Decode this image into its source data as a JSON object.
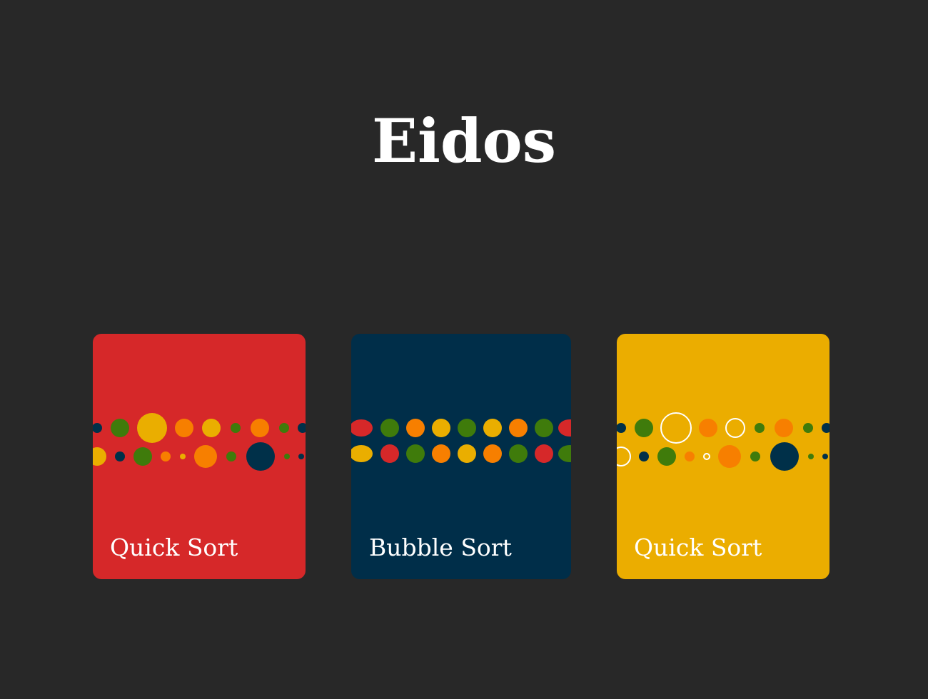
{
  "app": {
    "title": "Eidos"
  },
  "cards": [
    {
      "label": "Quick Sort",
      "background": "#d62829",
      "row1": [
        {
          "color": "#003049",
          "size": "sm"
        },
        {
          "color": "#3f7b0b",
          "size": "md"
        },
        {
          "color": "#eaae00",
          "size": "xl"
        },
        {
          "color": "#f77f00",
          "size": "md"
        },
        {
          "color": "#eaae00",
          "size": "md"
        },
        {
          "color": "#3f7b0b",
          "size": "sm"
        },
        {
          "color": "#f77f00",
          "size": "md"
        },
        {
          "color": "#3f7b0b",
          "size": "sm"
        },
        {
          "color": "#003049",
          "size": "sm"
        }
      ],
      "row2": [
        {
          "color": "#eaae00",
          "size": "md"
        },
        {
          "color": "#003049",
          "size": "sm"
        },
        {
          "color": "#3f7b0b",
          "size": "md"
        },
        {
          "color": "#f77f00",
          "size": "sm"
        },
        {
          "color": "#eaae00",
          "size": "xs"
        },
        {
          "color": "#f77f00",
          "size": "lg"
        },
        {
          "color": "#3f7b0b",
          "size": "sm"
        },
        {
          "color": "#003049",
          "size": "xxl"
        },
        {
          "color": "#3f7b0b",
          "size": "xs"
        },
        {
          "color": "#003049",
          "size": "xs"
        }
      ]
    },
    {
      "label": "Bubble Sort",
      "background": "#002e49",
      "row1": [
        {
          "color": "#d62829",
          "size": "md"
        },
        {
          "color": "#3f7b0b",
          "size": "md"
        },
        {
          "color": "#f77f00",
          "size": "md"
        },
        {
          "color": "#eaae00",
          "size": "md"
        },
        {
          "color": "#3f7b0b",
          "size": "md"
        },
        {
          "color": "#eaae00",
          "size": "md"
        },
        {
          "color": "#f77f00",
          "size": "md"
        },
        {
          "color": "#3f7b0b",
          "size": "md"
        },
        {
          "color": "#d62829",
          "size": "md"
        }
      ],
      "row2": [
        {
          "color": "#eaae00",
          "size": "md"
        },
        {
          "color": "#d62829",
          "size": "md"
        },
        {
          "color": "#3f7b0b",
          "size": "md"
        },
        {
          "color": "#f77f00",
          "size": "md"
        },
        {
          "color": "#eaae00",
          "size": "md"
        },
        {
          "color": "#f77f00",
          "size": "md"
        },
        {
          "color": "#3f7b0b",
          "size": "md"
        },
        {
          "color": "#d62829",
          "size": "md"
        },
        {
          "color": "#3f7b0b",
          "size": "md"
        }
      ]
    },
    {
      "label": "Quick Sort",
      "background": "#ebad00",
      "row1": [
        {
          "color": "#003049",
          "size": "sm"
        },
        {
          "color": "#3f7b0b",
          "size": "md"
        },
        {
          "color": "#ffffff",
          "size": "xl",
          "outline": true
        },
        {
          "color": "#f77f00",
          "size": "md"
        },
        {
          "color": "#ffffff",
          "size": "md",
          "outline": true
        },
        {
          "color": "#3f7b0b",
          "size": "sm"
        },
        {
          "color": "#f77f00",
          "size": "md"
        },
        {
          "color": "#3f7b0b",
          "size": "sm"
        },
        {
          "color": "#003049",
          "size": "sm"
        }
      ],
      "row2": [
        {
          "color": "#ffffff",
          "size": "md",
          "outline": true
        },
        {
          "color": "#003049",
          "size": "sm"
        },
        {
          "color": "#3f7b0b",
          "size": "md"
        },
        {
          "color": "#f77f00",
          "size": "sm"
        },
        {
          "color": "#ffffff",
          "size": "xs",
          "outline": true
        },
        {
          "color": "#f77f00",
          "size": "lg"
        },
        {
          "color": "#3f7b0b",
          "size": "sm"
        },
        {
          "color": "#003049",
          "size": "xxl"
        },
        {
          "color": "#3f7b0b",
          "size": "xs"
        },
        {
          "color": "#003049",
          "size": "xs"
        }
      ]
    }
  ]
}
